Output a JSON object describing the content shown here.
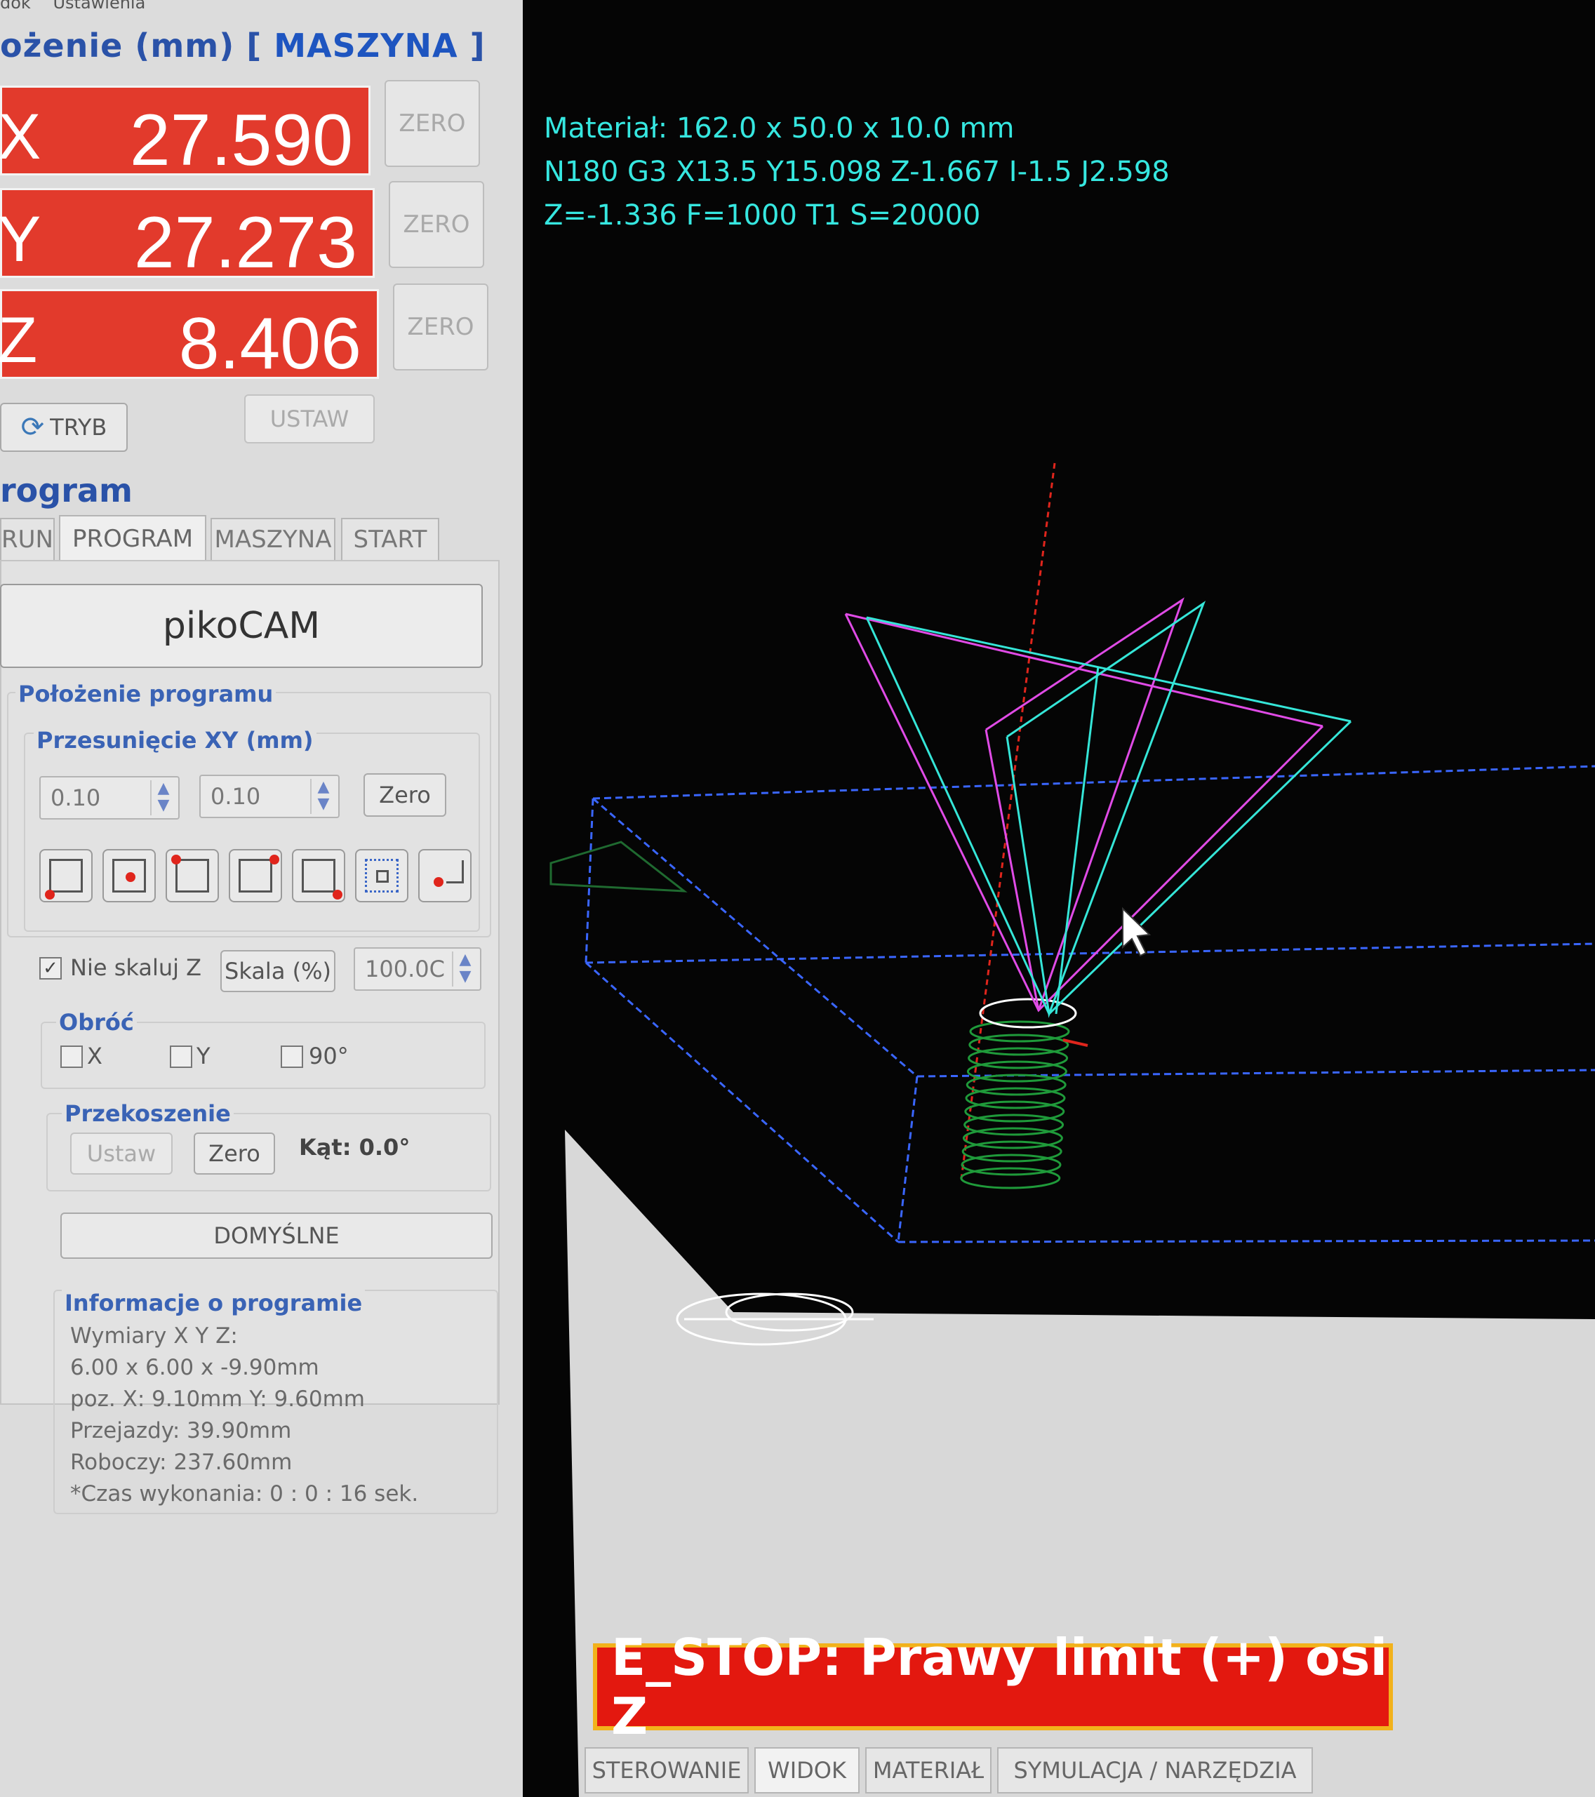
{
  "menu": [
    "dok",
    "Ustawienia"
  ],
  "position": {
    "title_prefix": "ożenie (mm) [",
    "mode": "MASZYNA",
    "title_suffix": "]",
    "axes": [
      {
        "label": "X",
        "value": "27.590"
      },
      {
        "label": "Y",
        "value": "27.273"
      },
      {
        "label": "Z",
        "value": "8.406"
      }
    ],
    "zero_label": "ZERO",
    "tryb_label": "TRYB",
    "ustaw_label": "USTAW"
  },
  "program": {
    "title": "rogram",
    "tabs": [
      "RUN",
      "PROGRAM",
      "MASZYNA",
      "START"
    ],
    "active_tab": "PROGRAM",
    "pikocam_label": "pikoCAM",
    "placement_title": "Położenie programu",
    "offset_title": "Przesunięcie XY (mm)",
    "offset_x": "0.10",
    "offset_y": "0.10",
    "zero_btn": "Zero",
    "no_scale_z": "Nie skaluj Z",
    "scale_btn": "Skala (%)",
    "scale_value": "100.0C",
    "rotate_title": "Obróć",
    "rotate_x": "X",
    "rotate_y": "Y",
    "rotate_90": "90°",
    "skew_title": "Przekoszenie",
    "skew_set": "Ustaw",
    "skew_zero": "Zero",
    "skew_angle": "Kąt: 0.0°",
    "defaults_btn": "DOMYŚLNE",
    "info_title": "Informacje o programie",
    "info_lines": [
      "Wymiary X Y Z:",
      "6.00 x 6.00 x -9.90mm",
      "poz. X: 9.10mm Y: 9.60mm",
      "Przejazdy: 39.90mm",
      "Roboczy: 237.60mm",
      "*Czas wykonania: 0 : 0 : 16 sek."
    ]
  },
  "viewport": {
    "hud_lines": [
      "Materiał: 162.0 x 50.0 x 10.0 mm",
      "N180 G3 X13.5 Y15.098 Z-1.667 I-1.5 J2.598",
      "Z=-1.336 F=1000 T1 S=20000"
    ],
    "estop": "E_STOP: Prawy limit (+) osi Z",
    "colors": {
      "hud": "#36e7e0",
      "estop_bg": "#e3180f",
      "estop_border": "#f2b21b",
      "magenta": "#e04be6",
      "cyan": "#35e6d8",
      "blue": "#3a66ff",
      "green": "#1f9a3a"
    }
  },
  "bottom_tabs": [
    "STEROWANIE",
    "WIDOK",
    "MATERIAŁ",
    "SYMULACJA / NARZĘDZIA"
  ],
  "bottom_active": "WIDOK"
}
